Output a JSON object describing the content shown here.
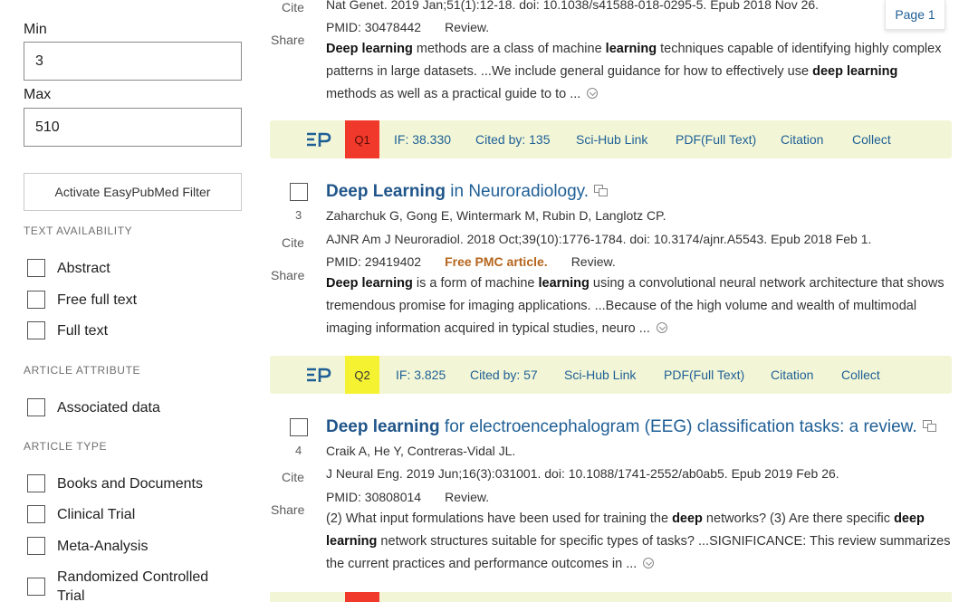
{
  "filters": {
    "min_label": "Min",
    "min_value": "3",
    "max_label": "Max",
    "max_value": "510",
    "activate_button": "Activate EasyPubMed Filter",
    "text_availability": {
      "heading": "TEXT AVAILABILITY",
      "options": [
        "Abstract",
        "Free full text",
        "Full text"
      ]
    },
    "article_attribute": {
      "heading": "ARTICLE ATTRIBUTE",
      "options": [
        "Associated data"
      ]
    },
    "article_type": {
      "heading": "ARTICLE TYPE",
      "options": [
        "Books and Documents",
        "Clinical Trial",
        "Meta-Analysis",
        "Randomized Controlled Trial"
      ]
    }
  },
  "page_indicator": "Page 1",
  "side_actions": {
    "cite": "Cite",
    "share": "Share"
  },
  "results": [
    {
      "number": "",
      "journal": "Nat Genet. 2019 Jan;51(1):12-18. doi: 10.1038/s41588-018-0295-5. Epub 2018 Nov 26.",
      "pmid": "PMID: 30478442",
      "free_pmc": "",
      "review": "Review.",
      "snippet": [
        {
          "t": "Deep learning",
          "b": true
        },
        {
          "t": " methods are a class of machine ",
          "b": false
        },
        {
          "t": "learning",
          "b": true
        },
        {
          "t": " techniques capable of identifying highly complex patterns in large datasets. ...We include general guidance for how to effectively use ",
          "b": false
        },
        {
          "t": "deep learning",
          "b": true
        },
        {
          "t": " methods as well as a practical guide to to ... ",
          "b": false
        }
      ],
      "bar": {
        "quartile": "Q1",
        "quartile_color": "#f0392b",
        "impact_factor": "IF: 38.330",
        "cited_by": "Cited by: 135",
        "scihub": "Sci-Hub Link",
        "pdf": "PDF(Full Text)",
        "citation": "Citation",
        "collect": "Collect"
      }
    },
    {
      "number": "3",
      "title_bold": "Deep Learning",
      "title_rest": " in Neuroradiology.",
      "authors": "Zaharchuk G, Gong E, Wintermark M, Rubin D, Langlotz CP.",
      "journal": "AJNR Am J Neuroradiol. 2018 Oct;39(10):1776-1784. doi: 10.3174/ajnr.A5543. Epub 2018 Feb 1.",
      "pmid": "PMID: 29419402",
      "free_pmc": "Free PMC article.",
      "review": "Review.",
      "snippet": [
        {
          "t": "Deep learning",
          "b": true
        },
        {
          "t": " is a form of machine ",
          "b": false
        },
        {
          "t": "learning",
          "b": true
        },
        {
          "t": " using a convolutional neural network architecture that shows tremendous promise for imaging applications. ...Because of the high volume and wealth of multimodal imaging information acquired in typical studies, neuro ... ",
          "b": false
        }
      ],
      "bar": {
        "quartile": "Q2",
        "quartile_color": "#f5f232",
        "impact_factor": "IF: 3.825",
        "cited_by": "Cited by: 57",
        "scihub": "Sci-Hub Link",
        "pdf": "PDF(Full Text)",
        "citation": "Citation",
        "collect": "Collect"
      }
    },
    {
      "number": "4",
      "title_bold": "Deep learning",
      "title_rest": " for electroencephalogram (EEG) classification tasks: a review.",
      "authors": "Craik A, He Y, Contreras-Vidal JL.",
      "journal": "J Neural Eng. 2019 Jun;16(3):031001. doi: 10.1088/1741-2552/ab0ab5. Epub 2019 Feb 26.",
      "pmid": "PMID: 30808014",
      "free_pmc": "",
      "review": "Review.",
      "snippet": [
        {
          "t": "(2) What input formulations have been used for training the ",
          "b": false
        },
        {
          "t": "deep",
          "b": true
        },
        {
          "t": " networks? (3) Are there specific ",
          "b": false
        },
        {
          "t": "deep learning",
          "b": true
        },
        {
          "t": " network structures suitable for specific types of tasks? ...SIGNIFICANCE: This review summarizes the current practices and performance outcomes in ... ",
          "b": false
        }
      ]
    }
  ],
  "colors": {
    "link_blue": "#1f5f96",
    "bar_bg": "#f2f6d6",
    "q1_red": "#f0392b",
    "q2_yellow": "#f5f232",
    "free_pmc_orange": "#b5651d"
  },
  "icons": {
    "easypubmed_logo": "ep-logo-icon",
    "similar_articles": "similar-articles-icon",
    "expand_snippet": "expand-snippet-icon"
  }
}
